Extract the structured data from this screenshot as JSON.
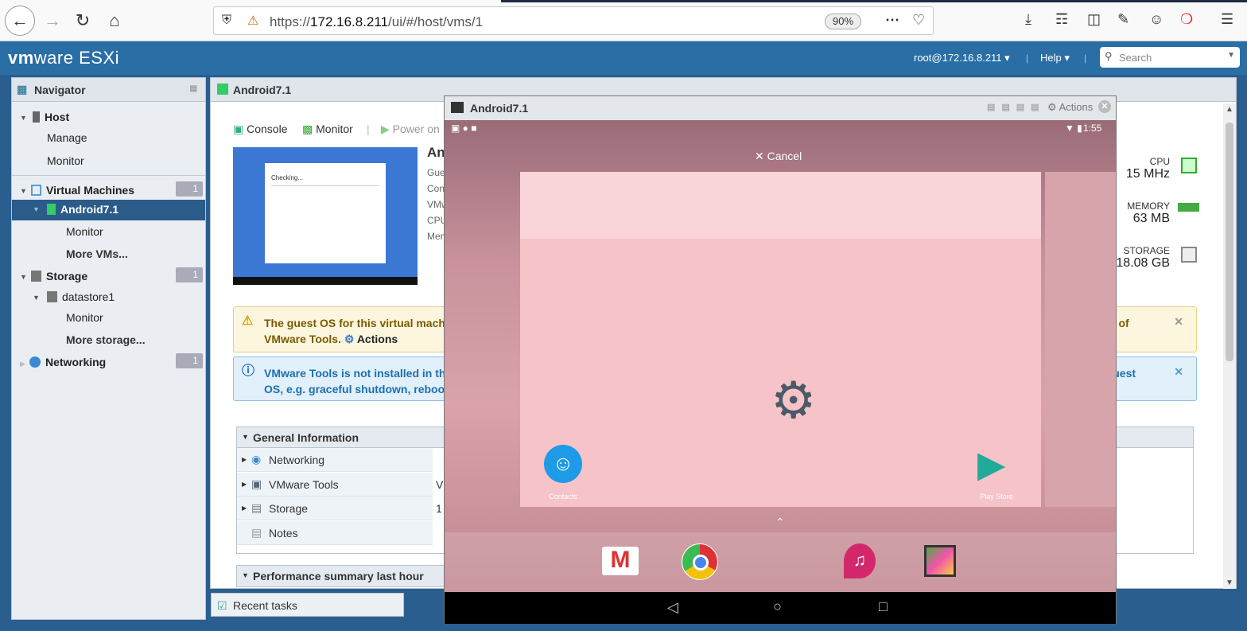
{
  "browser": {
    "url_prefix": "https://",
    "url_host": "172.16.8.211",
    "url_path": "/ui/#/host/vms/1",
    "zoom": "90%"
  },
  "header": {
    "logo_vm": "vm",
    "logo_rest": "ware",
    "logo_product": "ESXi",
    "user": "root@172.16.8.211",
    "help": "Help",
    "search_placeholder": "Search"
  },
  "navigator": {
    "title": "Navigator",
    "host": "Host",
    "host_manage": "Manage",
    "host_monitor": "Monitor",
    "vms": "Virtual Machines",
    "vms_count": "1",
    "vm_selected": "Android7.1",
    "vm_monitor": "Monitor",
    "more_vms": "More VMs...",
    "storage": "Storage",
    "storage_count": "1",
    "datastore": "datastore1",
    "ds_monitor": "Monitor",
    "more_storage": "More storage...",
    "networking": "Networking",
    "networking_count": "1"
  },
  "main": {
    "title": "Android7.1",
    "toolbar": {
      "console": "Console",
      "monitor": "Monitor",
      "power_on": "Power on"
    },
    "thumb_text": "Checking...",
    "vm_name_partial": "An",
    "labels": [
      "Gue",
      "Con",
      "VMw",
      "CPU",
      "Mem"
    ],
    "stats": {
      "cpu_label": "CPU",
      "cpu_value": "15 MHz",
      "mem_label": "MEMORY",
      "mem_value": "63 MB",
      "storage_label": "STORAGE",
      "storage_value": "18.08 GB"
    },
    "warn_line1": "The guest OS for this virtual machin",
    "warn_line1_end": "n of",
    "warn_line2": "VMware Tools.",
    "warn_actions": "Actions",
    "info_line1": "VMware Tools is not installed in this",
    "info_line1_end": "e guest",
    "info_line2": "OS, e.g. graceful shutdown, reboot,",
    "general_info": "General Information",
    "rows": [
      {
        "label": "Networking",
        "value": ""
      },
      {
        "label": "VMware Tools",
        "value": "V"
      },
      {
        "label": "Storage",
        "value": "1"
      },
      {
        "label": "Notes",
        "value": ""
      }
    ],
    "perf": "Performance summary last hour",
    "recent_tasks": "Recent tasks"
  },
  "console": {
    "title": "Android7.1",
    "actions": "Actions",
    "time": "1:55",
    "cancel": "Cancel",
    "contacts": "Contacts",
    "play_store": "Play Store"
  }
}
